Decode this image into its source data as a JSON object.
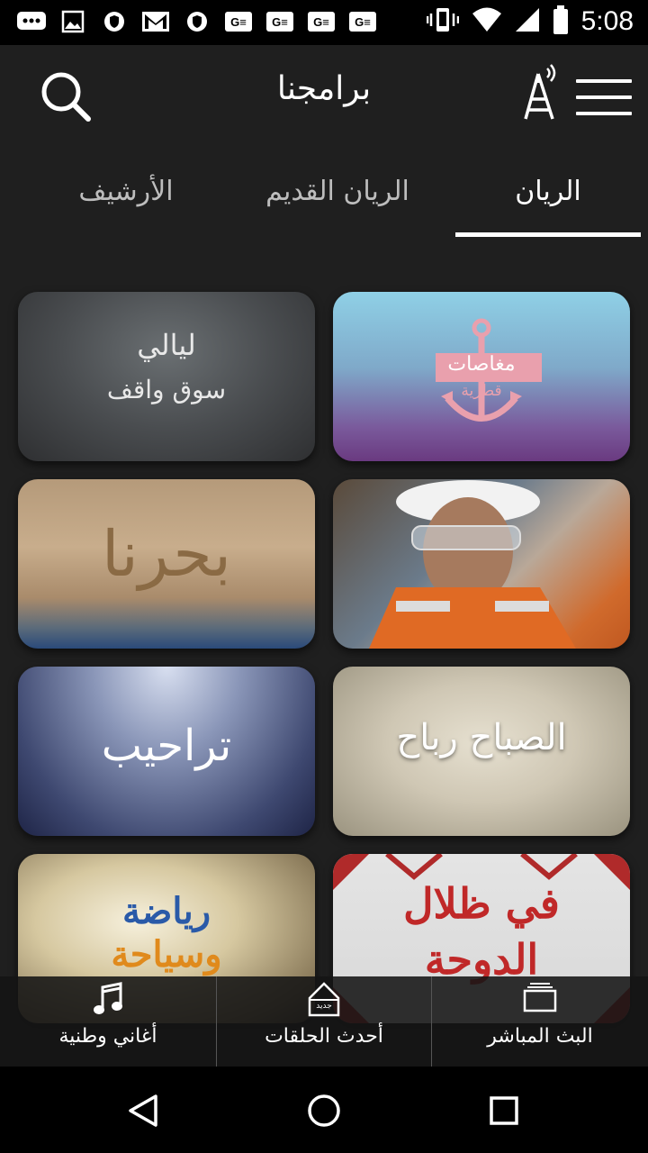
{
  "status_bar": {
    "time": "5:08",
    "icons": [
      "message-icon",
      "image-icon",
      "vpn-icon",
      "gmail-icon",
      "vpn-icon",
      "ge-icon",
      "ge-icon",
      "ge-icon",
      "ge-icon",
      "vibrate-icon",
      "wifi-icon",
      "signal-icon",
      "battery-icon"
    ]
  },
  "app_bar": {
    "title": "برامجنا"
  },
  "tabs": [
    {
      "label": "الريان",
      "active": true
    },
    {
      "label": "الريان القديم",
      "active": false
    },
    {
      "label": "الأرشيف",
      "active": false
    }
  ],
  "programs": [
    {
      "title_line1": "مغاصات",
      "title_line2": "قطرية"
    },
    {
      "title_line1": "ليالي",
      "title_line2": "سوق واقف"
    },
    {
      "title_line1": "",
      "title_line2": ""
    },
    {
      "title_line1": "بحرنا",
      "title_line2": ""
    },
    {
      "title_line1": "الصباح رباح",
      "title_line2": ""
    },
    {
      "title_line1": "تراحيب",
      "title_line2": ""
    },
    {
      "title_line1": "في ظلال",
      "title_line2": "الدوحة"
    },
    {
      "title_line1": "رياضة",
      "title_line2": "وسياحة"
    }
  ],
  "bottom_nav": [
    {
      "label": "البث المباشر",
      "icon": "tv-icon"
    },
    {
      "label": "أحدث الحلقات",
      "icon": "new-badge-icon",
      "badge": "جديد"
    },
    {
      "label": "أغاني وطنية",
      "icon": "music-note-icon"
    }
  ],
  "colors": {
    "background": "#1f1f1f",
    "status_bar": "#000000",
    "tab_inactive": "#bdbdbd",
    "accent": "#ffffff"
  }
}
